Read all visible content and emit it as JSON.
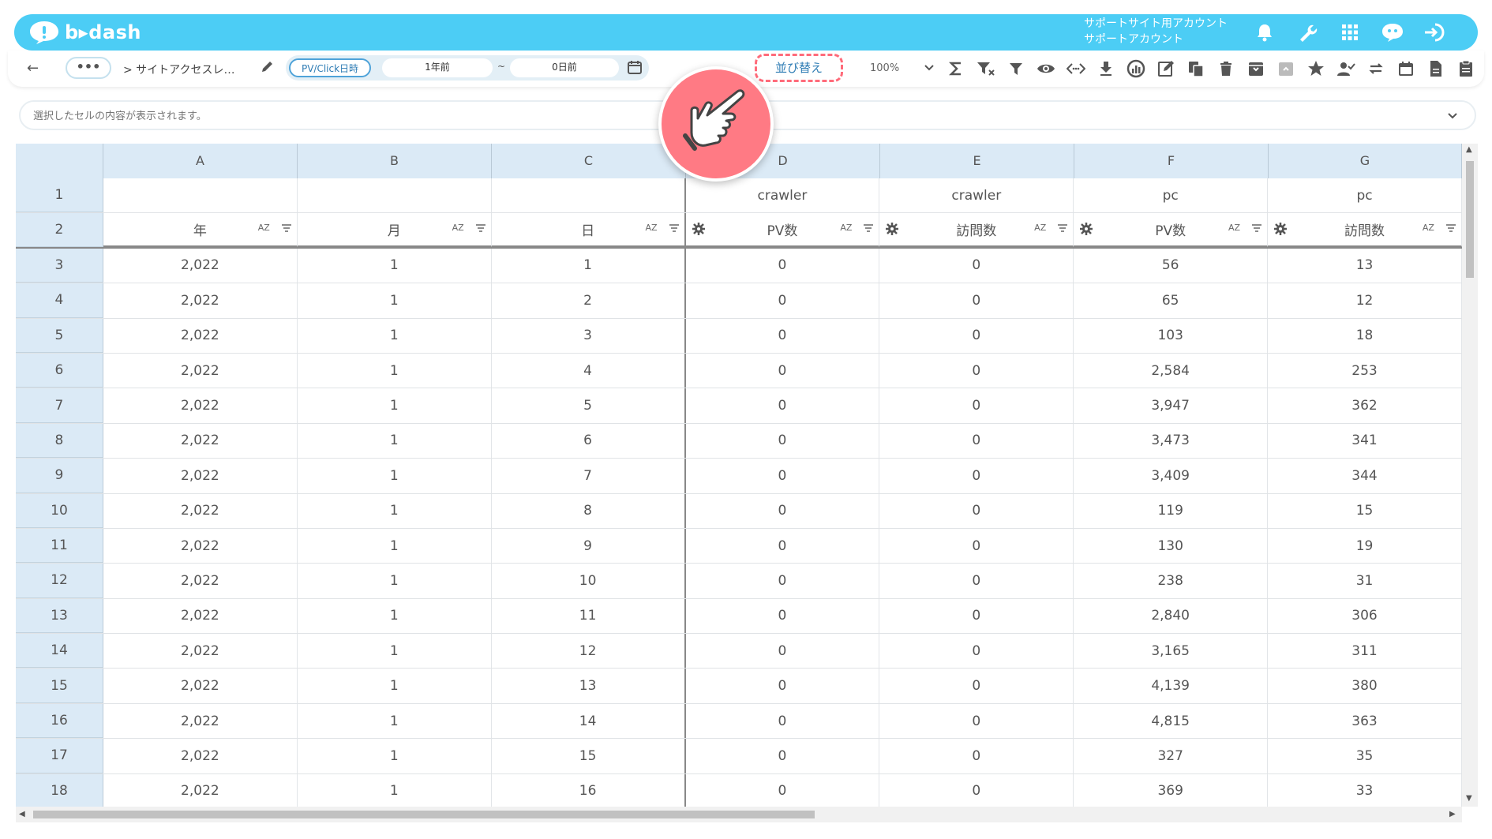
{
  "app": {
    "logo_text": "b▸dash",
    "account_line1": "サポートサイト用アカウント",
    "account_line2": "サポートアカウント"
  },
  "top_icons": [
    "bell-icon",
    "wrench-icon",
    "grid-icon",
    "support-bubble-icon",
    "logout-icon"
  ],
  "toolbar": {
    "back_label": "←",
    "more_label": "•••",
    "breadcrumb": "> サイトアクセスレ…",
    "date_mode": "PV/Click日時",
    "date_from": "1年前",
    "date_sep": "~",
    "date_to": "0日前",
    "sort_label": "並び替え",
    "zoom": "100%"
  },
  "tool_icons": [
    "sigma-icon",
    "filter-clear-icon",
    "filter-icon",
    "eye-icon",
    "code-icon",
    "download-icon",
    "chart-icon",
    "edit-note-icon",
    "copy-icon",
    "trash-icon",
    "archive-icon",
    "unarchive-icon",
    "star-icon",
    "user-check-icon",
    "refresh-icon",
    "calendar-icon",
    "document-icon",
    "clipboard-icon"
  ],
  "cell_bar": {
    "placeholder": "選択したセルの内容が表示されます。"
  },
  "sheet": {
    "columns": [
      "A",
      "B",
      "C",
      "D",
      "E",
      "F",
      "G"
    ],
    "row1": [
      "",
      "",
      "",
      "crawler",
      "crawler",
      "pc",
      "pc"
    ],
    "row2": [
      "年",
      "月",
      "日",
      "PV数",
      "訪問数",
      "PV数",
      "訪問数"
    ],
    "sort_glyph": "AZ",
    "rows": [
      {
        "n": "3",
        "cells": [
          "2,022",
          "1",
          "1",
          "0",
          "0",
          "56",
          "13"
        ]
      },
      {
        "n": "4",
        "cells": [
          "2,022",
          "1",
          "2",
          "0",
          "0",
          "65",
          "12"
        ]
      },
      {
        "n": "5",
        "cells": [
          "2,022",
          "1",
          "3",
          "0",
          "0",
          "103",
          "18"
        ]
      },
      {
        "n": "6",
        "cells": [
          "2,022",
          "1",
          "4",
          "0",
          "0",
          "2,584",
          "253"
        ]
      },
      {
        "n": "7",
        "cells": [
          "2,022",
          "1",
          "5",
          "0",
          "0",
          "3,947",
          "362"
        ]
      },
      {
        "n": "8",
        "cells": [
          "2,022",
          "1",
          "6",
          "0",
          "0",
          "3,473",
          "341"
        ]
      },
      {
        "n": "9",
        "cells": [
          "2,022",
          "1",
          "7",
          "0",
          "0",
          "3,409",
          "344"
        ]
      },
      {
        "n": "10",
        "cells": [
          "2,022",
          "1",
          "8",
          "0",
          "0",
          "119",
          "15"
        ]
      },
      {
        "n": "11",
        "cells": [
          "2,022",
          "1",
          "9",
          "0",
          "0",
          "130",
          "19"
        ]
      },
      {
        "n": "12",
        "cells": [
          "2,022",
          "1",
          "10",
          "0",
          "0",
          "238",
          "31"
        ]
      },
      {
        "n": "13",
        "cells": [
          "2,022",
          "1",
          "11",
          "0",
          "0",
          "2,840",
          "306"
        ]
      },
      {
        "n": "14",
        "cells": [
          "2,022",
          "1",
          "12",
          "0",
          "0",
          "3,165",
          "311"
        ]
      },
      {
        "n": "15",
        "cells": [
          "2,022",
          "1",
          "13",
          "0",
          "0",
          "4,139",
          "380"
        ]
      },
      {
        "n": "16",
        "cells": [
          "2,022",
          "1",
          "14",
          "0",
          "0",
          "4,815",
          "363"
        ]
      },
      {
        "n": "17",
        "cells": [
          "2,022",
          "1",
          "15",
          "0",
          "0",
          "327",
          "35"
        ]
      },
      {
        "n": "18",
        "cells": [
          "2,022",
          "1",
          "16",
          "0",
          "0",
          "369",
          "33"
        ]
      }
    ]
  },
  "colors": {
    "topbar": "#4ccdf5",
    "header_bg": "#dbeaf6",
    "highlight": "#ff6b7a",
    "accent_text": "#2e7cb4"
  }
}
